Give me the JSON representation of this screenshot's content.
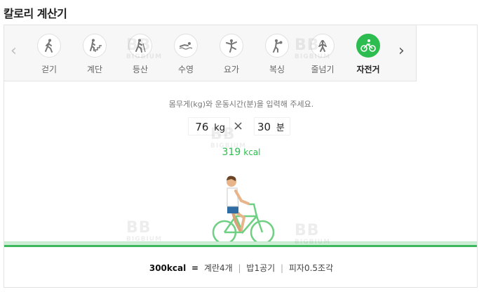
{
  "page": {
    "title": "칼로리 계산기"
  },
  "tabs": [
    {
      "label": "걷기",
      "icon": "walking-icon",
      "active": false
    },
    {
      "label": "계단",
      "icon": "stairs-icon",
      "active": false
    },
    {
      "label": "등산",
      "icon": "hiking-icon",
      "active": false
    },
    {
      "label": "수영",
      "icon": "swimming-icon",
      "active": false
    },
    {
      "label": "요가",
      "icon": "yoga-icon",
      "active": false
    },
    {
      "label": "복싱",
      "icon": "boxing-icon",
      "active": false
    },
    {
      "label": "줄넘기",
      "icon": "jump-rope-icon",
      "active": false
    },
    {
      "label": "자전거",
      "icon": "bicycle-icon",
      "active": true
    }
  ],
  "nav": {
    "prev": "‹",
    "next": "›"
  },
  "form": {
    "instruction": "몸무게(kg)와 운동시간(분)을 입력해 주세요.",
    "weight_value": "76",
    "weight_unit": "kg",
    "times_symbol": "×",
    "time_value": "30",
    "time_unit": "분"
  },
  "result": {
    "value": "319",
    "unit": "kcal"
  },
  "equivalence": {
    "base": "300kcal",
    "equals": "=",
    "items": [
      "계란4개",
      "밥1공기",
      "피자0.5조각"
    ],
    "separator": "|"
  },
  "watermark": {
    "mark": "BB",
    "text": "BIGBIUM"
  },
  "colors": {
    "accent": "#2dbc4f",
    "ground": "#3db85c",
    "tabbar_bg": "#f7f7f7"
  }
}
